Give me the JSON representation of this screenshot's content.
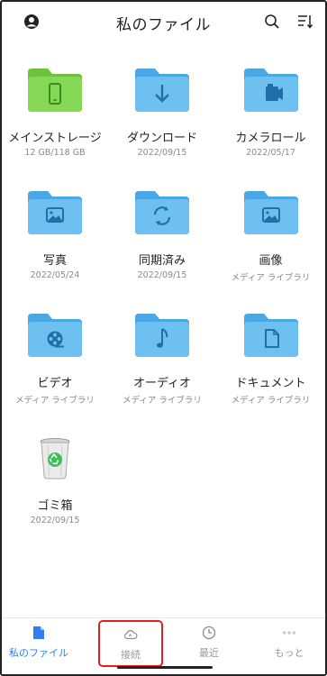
{
  "header": {
    "title": "私のファイル"
  },
  "items": [
    {
      "name": "メインストレージ",
      "sub": "12 GB/118 GB",
      "icon": "phone-storage-icon",
      "color": "#7ed14b"
    },
    {
      "name": "ダウンロード",
      "sub": "2022/09/15",
      "icon": "download-arrow-icon",
      "color": "#62b9ef"
    },
    {
      "name": "カメラロール",
      "sub": "2022/05/17",
      "icon": "camera-icon",
      "color": "#62b9ef"
    },
    {
      "name": "写真",
      "sub": "2022/05/24",
      "icon": "picture-icon",
      "color": "#62b9ef"
    },
    {
      "name": "同期済み",
      "sub": "2022/09/15",
      "icon": "sync-icon",
      "color": "#62b9ef"
    },
    {
      "name": "画像",
      "sub": "メディア ライブラリ",
      "icon": "picture-icon",
      "color": "#62b9ef"
    },
    {
      "name": "ビデオ",
      "sub": "メディア ライブラリ",
      "icon": "film-reel-icon",
      "color": "#62b9ef"
    },
    {
      "name": "オーディオ",
      "sub": "メディア ライブラリ",
      "icon": "music-note-icon",
      "color": "#62b9ef"
    },
    {
      "name": "ドキュメント",
      "sub": "メディア ライブラリ",
      "icon": "document-icon",
      "color": "#62b9ef"
    },
    {
      "name": "ゴミ箱",
      "sub": "2022/09/15",
      "icon": "recycle-bin-icon",
      "color": "#3fbf5a"
    }
  ],
  "tabs": {
    "myfiles": "私のファイル",
    "connect": "接続",
    "recent": "最近",
    "more": "もっと"
  }
}
